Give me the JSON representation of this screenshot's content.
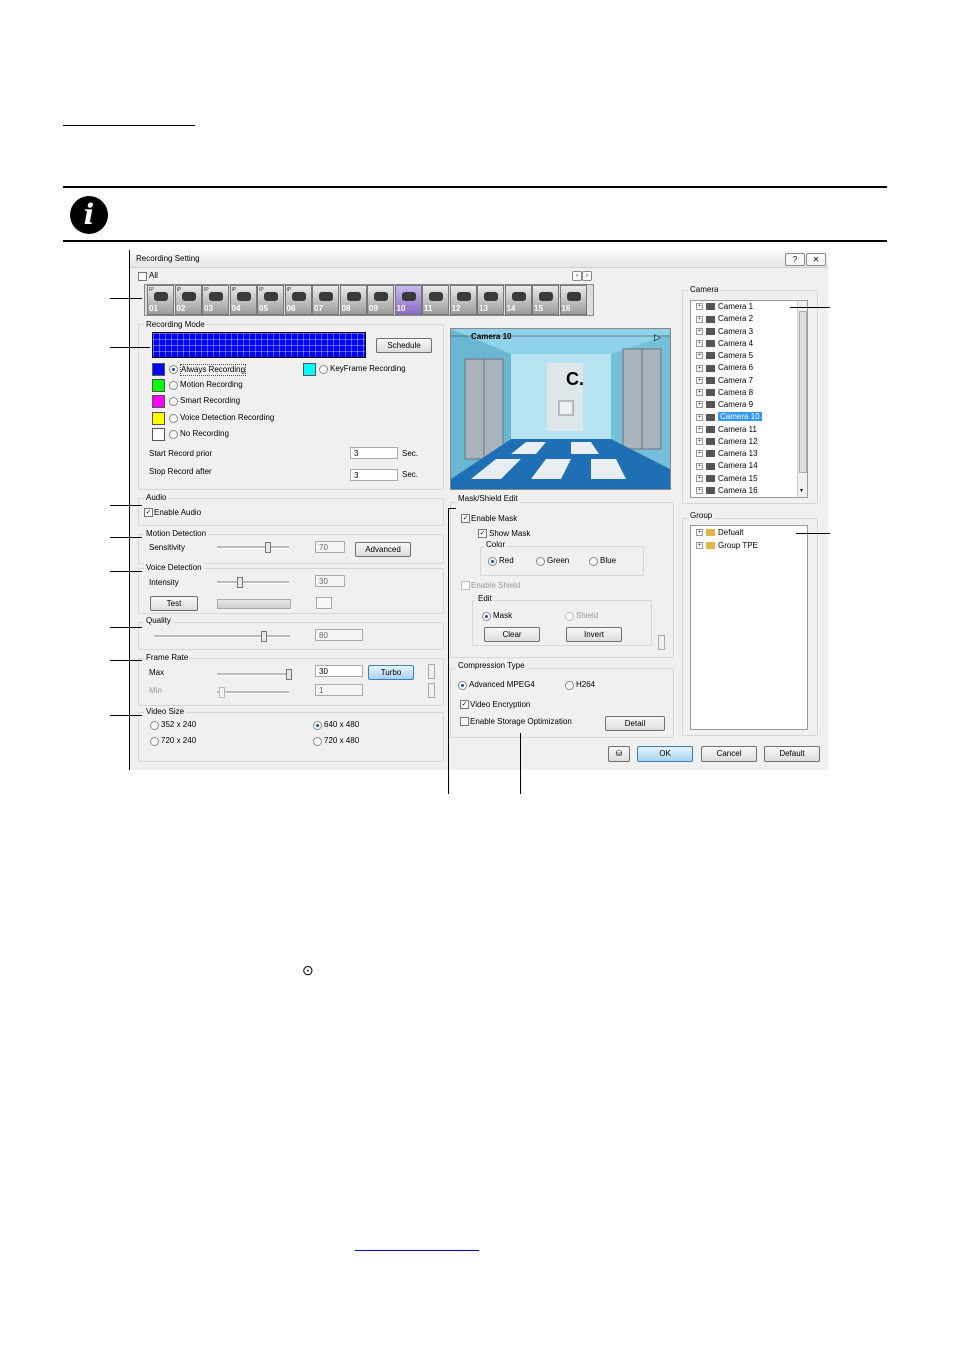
{
  "window": {
    "title": "Recording Setting",
    "help_label": "?",
    "close_label": "✕",
    "all_label": "All"
  },
  "channels": [
    {
      "label": "01"
    },
    {
      "label": "02"
    },
    {
      "label": "03"
    },
    {
      "label": "04"
    },
    {
      "label": "05"
    },
    {
      "label": "06"
    },
    {
      "label": "07"
    },
    {
      "label": "08"
    },
    {
      "label": "09"
    },
    {
      "label": "10"
    },
    {
      "label": "11"
    },
    {
      "label": "12"
    },
    {
      "label": "13"
    },
    {
      "label": "14"
    },
    {
      "label": "15"
    },
    {
      "label": "16"
    }
  ],
  "recording_mode": {
    "title": "Recording Mode",
    "schedule_label": "Schedule",
    "options": [
      {
        "label": "Always Recording",
        "color": "#0000ff",
        "selected": true
      },
      {
        "label": "Motion Recording",
        "color": "#00ff00",
        "selected": false
      },
      {
        "label": "Smart Recording",
        "color": "#ff00ff",
        "selected": false
      },
      {
        "label": "Voice Detection Recording",
        "color": "#ffff00",
        "selected": false
      },
      {
        "label": "No Recording",
        "color": "#ffffff",
        "selected": false
      }
    ],
    "keyframe": {
      "label": "KeyFrame Recording",
      "color": "#00ffff"
    },
    "start_label": "Start Record prior",
    "start_value": "3",
    "stop_label": "Stop Record after",
    "stop_value": "3",
    "unit": "Sec."
  },
  "audio": {
    "title": "Audio",
    "enable_label": "Enable Audio",
    "enabled": true
  },
  "motion": {
    "title": "Motion Detection",
    "sensitivity_label": "Sensitivity",
    "value": "70",
    "level": 0.7,
    "advanced_label": "Advanced"
  },
  "voice": {
    "title": "Voice Detection",
    "intensity_label": "Intensity",
    "value": "30",
    "level": 0.3,
    "test_label": "Test"
  },
  "quality": {
    "title": "Quality",
    "value": "80",
    "level": 0.8
  },
  "frame_rate": {
    "title": "Frame Rate",
    "max_label": "Max",
    "max_value": "30",
    "min_label": "Min",
    "min_value": "1",
    "turbo_label": "Turbo"
  },
  "video_size": {
    "title": "Video Size",
    "options": [
      {
        "label": "352 x 240",
        "selected": false
      },
      {
        "label": "640 x 480",
        "selected": true
      },
      {
        "label": "720 x 240",
        "selected": false
      },
      {
        "label": "720 x 480",
        "selected": false
      }
    ]
  },
  "preview": {
    "camera_label": "Camera 10",
    "sign": "C."
  },
  "mask": {
    "title": "Mask/Shield Edit",
    "enable_mask_label": "Enable Mask",
    "enable_mask": true,
    "show_mask_label": "Show Mask",
    "show_mask": true,
    "color_label": "Color",
    "colors": [
      {
        "label": "Red",
        "selected": true
      },
      {
        "label": "Green",
        "selected": false
      },
      {
        "label": "Blue",
        "selected": false
      }
    ],
    "enable_shield_label": "Enable Shield",
    "edit_label": "Edit",
    "edit_options": [
      {
        "label": "Mask",
        "selected": true
      },
      {
        "label": "Shield",
        "selected": false
      }
    ],
    "clear_label": "Clear",
    "invert_label": "Invert"
  },
  "compression": {
    "title": "Compression Type",
    "options": [
      {
        "label": "Advanced MPEG4",
        "selected": true
      },
      {
        "label": "H264",
        "selected": false
      }
    ],
    "encryption_label": "Video Encryption",
    "encryption": true,
    "storage_label": "Enable Storage Optimization",
    "storage": false,
    "detail_label": "Detail"
  },
  "camera_panel": {
    "title": "Camera",
    "items": [
      "Camera 1",
      "Camera 2",
      "Camera 3",
      "Camera 4",
      "Camera 5",
      "Camera 6",
      "Camera 7",
      "Camera 8",
      "Camera 9",
      "Camera 10",
      "Camera 11",
      "Camera 12",
      "Camera 13",
      "Camera 14",
      "Camera 15",
      "Camera 16"
    ],
    "selected_index": 9
  },
  "group_panel": {
    "title": "Group",
    "items": [
      "Defualt",
      "Group TPE"
    ]
  },
  "footer": {
    "ok_label": "OK",
    "cancel_label": "Cancel",
    "default_label": "Default"
  },
  "page_marker": "⊙"
}
